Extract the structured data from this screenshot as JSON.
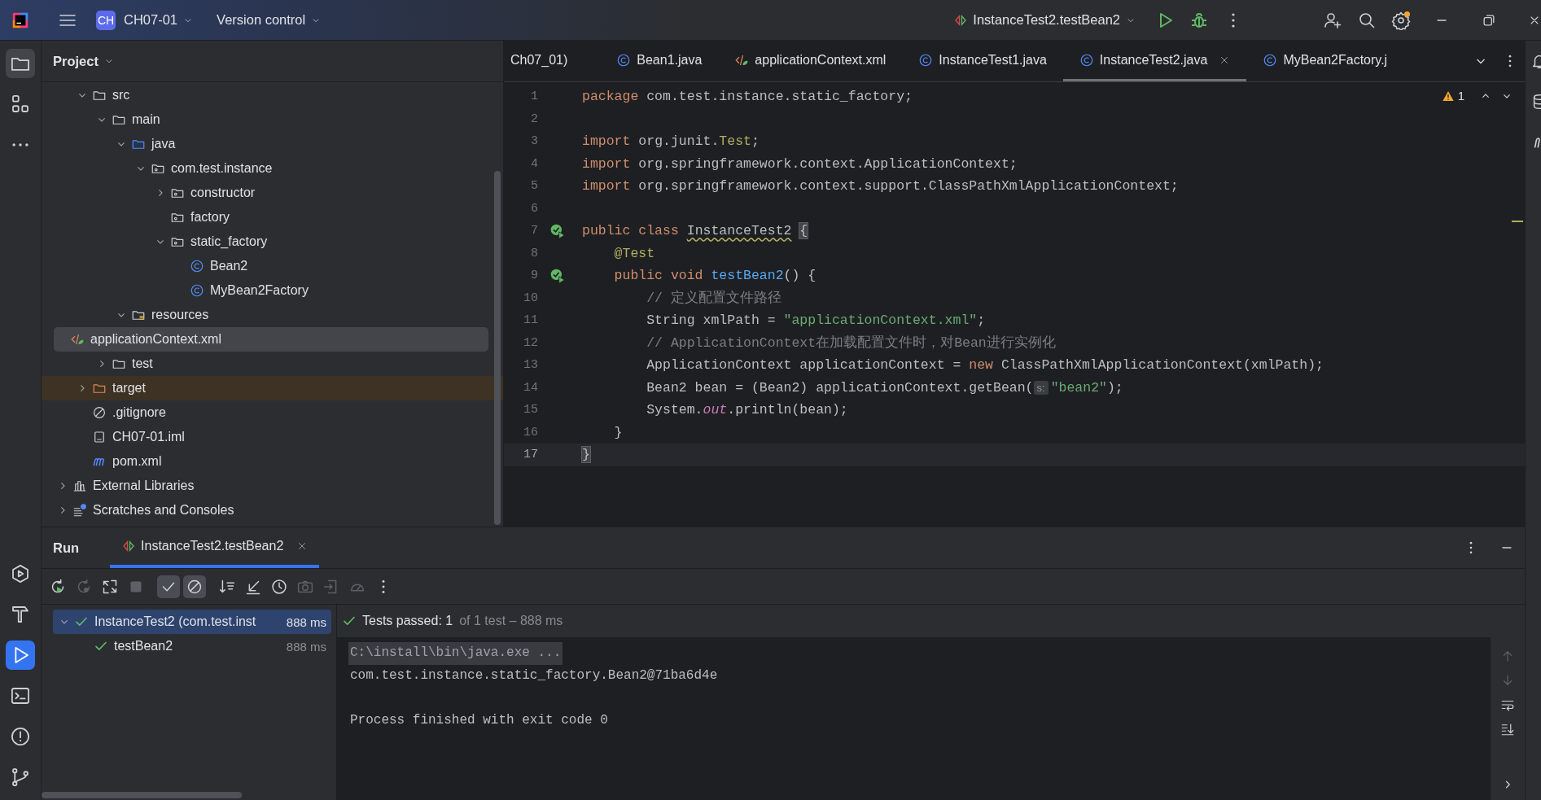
{
  "title_bar": {
    "project_badge": "CH",
    "project": "CH07-01",
    "vcs": "Version control",
    "run_config": "InstanceTest2.testBean2"
  },
  "left_strip": {
    "top": [
      {
        "kind": "project",
        "selected": true
      },
      {
        "kind": "structure",
        "selected": false
      },
      {
        "kind": "more",
        "selected": false
      }
    ],
    "bottom": [
      {
        "kind": "services",
        "selected": false
      },
      {
        "kind": "build",
        "selected": false
      },
      {
        "kind": "run",
        "selected": true
      },
      {
        "kind": "terminal",
        "selected": false
      },
      {
        "kind": "problems",
        "selected": false
      },
      {
        "kind": "git",
        "selected": false
      }
    ]
  },
  "project_panel": {
    "title": "Project",
    "items": [
      {
        "label": "src",
        "kind": "folder",
        "expanded": true,
        "selected": false,
        "children": [
          {
            "label": "main",
            "kind": "folder",
            "expanded": true,
            "selected": false,
            "children": [
              {
                "label": "java",
                "kind": "source-folder",
                "expanded": true,
                "selected": false,
                "children": [
                  {
                    "label": "com.test.instance",
                    "kind": "package",
                    "expanded": true,
                    "selected": false,
                    "children": [
                      {
                        "label": "constructor",
                        "kind": "package",
                        "expanded": false,
                        "selected": false
                      },
                      {
                        "label": "factory",
                        "kind": "package",
                        "selected": false
                      },
                      {
                        "label": "static_factory",
                        "kind": "package",
                        "expanded": true,
                        "selected": false,
                        "children": [
                          {
                            "label": "Bean2",
                            "kind": "class",
                            "selected": false
                          },
                          {
                            "label": "MyBean2Factory",
                            "kind": "class",
                            "selected": false
                          }
                        ]
                      }
                    ]
                  }
                ]
              },
              {
                "label": "resources",
                "kind": "resources-folder",
                "expanded": true,
                "selected": false,
                "children": [
                  {
                    "label": "applicationContext.xml",
                    "kind": "xml",
                    "selected": true
                  }
                ]
              }
            ]
          },
          {
            "label": "test",
            "kind": "folder",
            "expanded": false,
            "selected": false
          }
        ]
      },
      {
        "label": "target",
        "kind": "excluded-folder",
        "expanded": false,
        "selected": false
      },
      {
        "label": ".gitignore",
        "kind": "gitignore",
        "selected": false
      },
      {
        "label": "CH07-01.iml",
        "kind": "module-file",
        "selected": false
      },
      {
        "label": "pom.xml",
        "kind": "maven",
        "selected": false
      }
    ],
    "top_items": [
      {
        "label": "External Libraries",
        "kind": "libraries",
        "expanded": false,
        "selected": false
      },
      {
        "label": "Scratches and Consoles",
        "kind": "scratches",
        "expanded": false,
        "selected": false
      }
    ]
  },
  "editor": {
    "tabs": [
      {
        "label": "Ch07_01)",
        "selected": false
      },
      {
        "label": "Bean1.java",
        "kind": "class",
        "selected": false
      },
      {
        "label": "applicationContext.xml",
        "kind": "xml",
        "selected": false
      },
      {
        "label": "InstanceTest1.java",
        "kind": "class",
        "selected": false
      },
      {
        "label": "InstanceTest2.java",
        "kind": "class",
        "selected": true
      },
      {
        "label": "MyBean2Factory.j",
        "kind": "class",
        "selected": false
      }
    ],
    "warnings": "1",
    "lines": [
      {
        "number": "1",
        "current": false,
        "segments": [
          {
            "kind": "keyword",
            "text": "package"
          },
          {
            "kind": "plain",
            "text": " com.test.instance.static_factory;"
          }
        ]
      },
      {
        "number": "2",
        "current": false
      },
      {
        "number": "3",
        "current": false,
        "segments": [
          {
            "kind": "keyword",
            "text": "import"
          },
          {
            "kind": "plain",
            "text": " org.junit."
          },
          {
            "kind": "annotation",
            "text": "Test"
          },
          {
            "kind": "plain",
            "text": ";"
          }
        ]
      },
      {
        "number": "4",
        "current": false,
        "segments": [
          {
            "kind": "keyword",
            "text": "import"
          },
          {
            "kind": "plain",
            "text": " org.springframework.context.ApplicationContext;"
          }
        ]
      },
      {
        "number": "5",
        "current": false,
        "segments": [
          {
            "kind": "keyword",
            "text": "import"
          },
          {
            "kind": "plain",
            "text": " org.springframework.context.support.ClassPathXmlApplicationContext;"
          }
        ]
      },
      {
        "number": "6",
        "current": false
      },
      {
        "number": "7",
        "current": false,
        "kind": "run-test",
        "segments": [
          {
            "kind": "keyword",
            "text": "public class "
          },
          {
            "kind": "warning",
            "text": "InstanceTest2"
          },
          {
            "kind": "brace",
            "text": "{"
          }
        ]
      },
      {
        "number": "8",
        "current": false,
        "segments": [
          {
            "kind": "annotation",
            "text": "    @Test"
          }
        ]
      },
      {
        "number": "9",
        "current": false,
        "kind": "run-test",
        "segments": [
          {
            "kind": "keyword",
            "text": "    public void "
          },
          {
            "kind": "method",
            "text": "testBean2"
          },
          {
            "kind": "plain",
            "text": "() {"
          }
        ]
      },
      {
        "number": "10",
        "current": false,
        "segments": [
          {
            "kind": "comment",
            "text": "        // 定义配置文件路径"
          }
        ]
      },
      {
        "number": "11",
        "current": false,
        "segments": [
          {
            "kind": "plain",
            "text": "        String xmlPath = "
          },
          {
            "kind": "string",
            "text": "\"applicationContext.xml\""
          },
          {
            "kind": "plain",
            "text": ";"
          }
        ]
      },
      {
        "number": "12",
        "current": false,
        "segments": [
          {
            "kind": "comment",
            "text": "        // ApplicationContext在加载配置文件时，对Bean进行实例化"
          }
        ]
      },
      {
        "number": "13",
        "current": false,
        "segments": [
          {
            "kind": "plain",
            "text": "        ApplicationContext applicationContext = "
          },
          {
            "kind": "keyword",
            "text": "new"
          },
          {
            "kind": "plain",
            "text": " ClassPathXmlApplicationContext(xmlPath);"
          }
        ]
      },
      {
        "number": "14",
        "current": false,
        "segments": [
          {
            "kind": "plain",
            "text": "        Bean2 bean = (Bean2) applicationContext.getBean("
          },
          {
            "kind": "hint",
            "text": "s:"
          },
          {
            "kind": "string",
            "text": "\"bean2\""
          },
          {
            "kind": "plain",
            "text": ");"
          }
        ]
      },
      {
        "number": "15",
        "current": false,
        "segments": [
          {
            "kind": "plain",
            "text": "        System."
          },
          {
            "kind": "field",
            "text": "out"
          },
          {
            "kind": "plain",
            "text": ".println(bean);"
          }
        ]
      },
      {
        "number": "16",
        "current": false,
        "segments": [
          {
            "kind": "plain",
            "text": "    }"
          }
        ]
      },
      {
        "number": "17",
        "current": true,
        "segments": [
          {
            "kind": "brace",
            "text": "}"
          }
        ]
      }
    ]
  },
  "run_panel": {
    "title": "Run",
    "tab": {
      "label": "InstanceTest2.testBean2",
      "selected": true
    },
    "toolbar": [
      {
        "kind": "rerun",
        "disabled": false,
        "on": false
      },
      {
        "kind": "rerun-failed",
        "disabled": true,
        "on": false
      },
      {
        "kind": "auto-test",
        "disabled": false,
        "on": false
      },
      {
        "kind": "stop",
        "disabled": true,
        "on": false
      },
      {
        "kind": "show-passed",
        "disabled": false,
        "on": true
      },
      {
        "kind": "show-ignored",
        "disabled": false,
        "on": true
      },
      {
        "kind": "sort",
        "disabled": false,
        "on": false
      },
      {
        "kind": "collapse",
        "disabled": false,
        "on": false
      },
      {
        "kind": "history",
        "disabled": false,
        "on": false
      },
      {
        "kind": "camera",
        "disabled": true,
        "on": false
      },
      {
        "kind": "export",
        "disabled": true,
        "on": false
      },
      {
        "kind": "gauge",
        "disabled": true,
        "on": false
      },
      {
        "kind": "more",
        "disabled": false,
        "on": false
      }
    ],
    "tests": [
      {
        "label": "InstanceTest2 (com.test.inst",
        "time": "888 ms",
        "passed": true,
        "selected": true,
        "expanded": true,
        "children": [
          {
            "label": "testBean2",
            "time": "888 ms",
            "passed": true,
            "selected": false
          }
        ]
      }
    ],
    "status": "Tests passed: 1",
    "status_detail": "of 1 test – 888 ms",
    "console": [
      {
        "kind": "command",
        "text": "C:\\install\\bin\\java.exe ..."
      },
      {
        "kind": "output",
        "text": "com.test.instance.static_factory.Bean2@71ba6d4e"
      },
      {
        "kind": "exit",
        "text": "Process finished with exit code 0"
      }
    ]
  }
}
